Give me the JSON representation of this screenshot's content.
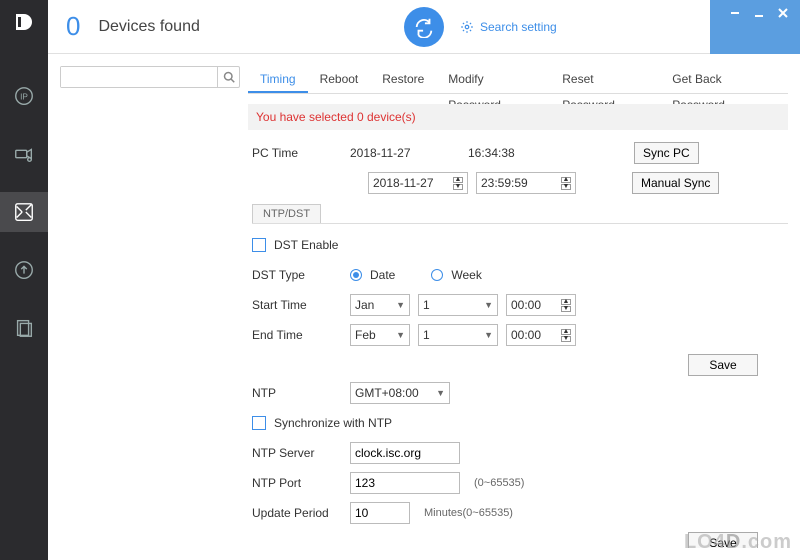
{
  "header": {
    "device_count": "0",
    "devices_found_label": "Devices found",
    "search_setting": "Search setting"
  },
  "sidebar": {
    "items": [
      "ip",
      "camera",
      "tools",
      "upload",
      "reports"
    ],
    "active_index": 2
  },
  "devlist": {
    "search_placeholder": ""
  },
  "tabs": {
    "items": [
      "Timing",
      "Reboot",
      "Restore",
      "Modify Password",
      "Reset Password",
      "Get Back Password"
    ],
    "active_index": 0
  },
  "banner": "You have selected 0 device(s)",
  "pctime": {
    "label": "PC Time",
    "date": "2018-11-27",
    "time": "16:34:38",
    "sync_pc_btn": "Sync PC",
    "manual_date": "2018-11-27",
    "manual_time": "23:59:59",
    "manual_sync_btn": "Manual Sync"
  },
  "ntp_dst_tab": "NTP/DST",
  "dst": {
    "enable_label": "DST Enable",
    "type_label": "DST Type",
    "date_option": "Date",
    "week_option": "Week",
    "selected_type": "date",
    "start_label": "Start Time",
    "start_month": "Jan",
    "start_day": "1",
    "start_time": "00:00",
    "end_label": "End Time",
    "end_month": "Feb",
    "end_day": "1",
    "end_time": "00:00",
    "save_btn": "Save"
  },
  "ntp": {
    "ntp_label": "NTP",
    "timezone": "GMT+08:00",
    "sync_label": "Synchronize with NTP",
    "server_label": "NTP Server",
    "server_value": "clock.isc.org",
    "port_label": "NTP Port",
    "port_value": "123",
    "port_hint": "(0~65535)",
    "period_label": "Update Period",
    "period_value": "10",
    "period_hint": "Minutes(0~65535)",
    "save_btn": "Save"
  },
  "watermark": "LO4D.com"
}
